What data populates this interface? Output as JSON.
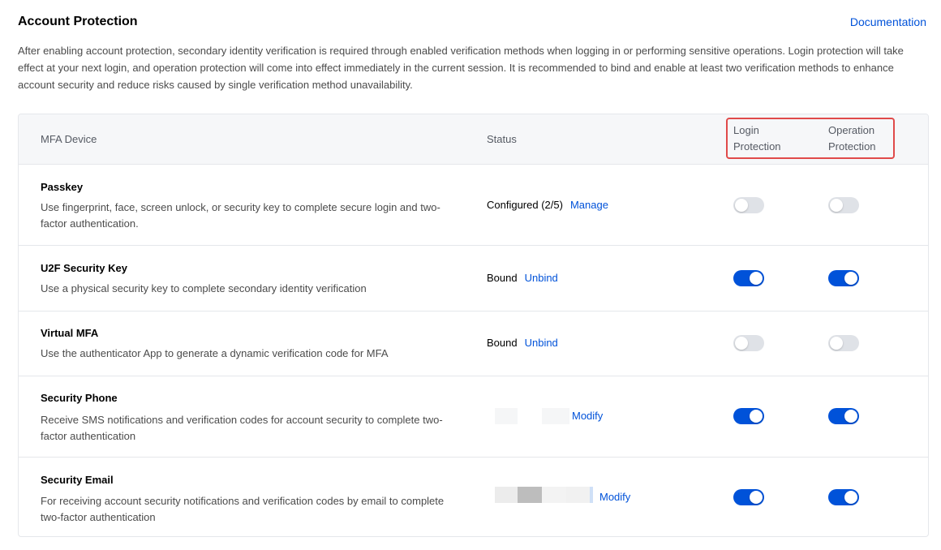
{
  "header": {
    "title": "Account Protection",
    "doc_link": "Documentation"
  },
  "description": "After enabling account protection, secondary identity verification is required through enabled verification methods when logging in or performing sensitive operations. Login protection will take effect at your next login, and operation protection will come into effect immediately in the current session. It is recommended to bind and enable at least two verification methods to enhance account security and reduce risks caused by single verification method unavailability.",
  "table": {
    "columns": {
      "device": "MFA Device",
      "status": "Status",
      "login_line1": "Login",
      "login_line2": "Protection",
      "op_line1": "Operation",
      "op_line2": "Protection"
    },
    "rows": [
      {
        "name": "Passkey",
        "desc": "Use fingerprint, face, screen unlock, or security key to complete secure login and two-factor authentication.",
        "status_text": "Configured (2/5)",
        "action": "Manage",
        "login_enabled": false,
        "op_enabled": false
      },
      {
        "name": "U2F Security Key",
        "desc": "Use a physical security key to complete secondary identity verification",
        "status_text": "Bound",
        "action": "Unbind",
        "login_enabled": true,
        "op_enabled": true
      },
      {
        "name": "Virtual MFA",
        "desc": "Use the authenticator App to generate a dynamic verification code for MFA",
        "status_text": "Bound",
        "action": "Unbind",
        "login_enabled": false,
        "op_enabled": false
      },
      {
        "name": "Security Phone",
        "desc": "Receive SMS notifications and verification codes for account security to complete two-factor authentication",
        "status_text": "",
        "action": "Modify",
        "login_enabled": true,
        "op_enabled": true
      },
      {
        "name": "Security Email",
        "desc": "For receiving account security notifications and verification codes by email to complete two-factor authentication",
        "status_text": "",
        "action": "Modify",
        "login_enabled": true,
        "op_enabled": true
      }
    ]
  },
  "colors": {
    "accent": "#0052d9",
    "toggle_off": "#dfe2e7",
    "highlight": "#e04a4a"
  }
}
